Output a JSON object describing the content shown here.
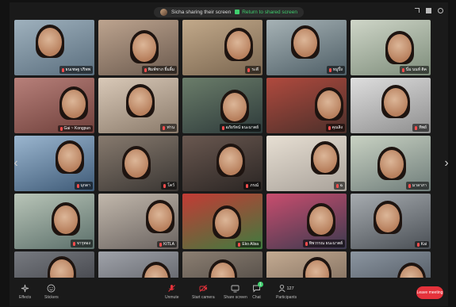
{
  "colors": {
    "accent_green": "#3fcf6e",
    "leave_red": "#e5323b"
  },
  "share_banner": {
    "text": "Sicha sharing their screen",
    "return_label": "Return to shared screen"
  },
  "toolbar": {
    "effects": "Effects",
    "stickers": "Stickers",
    "unmute": "Unmute",
    "start_camera": "Start camera",
    "share_screen": "Share screen",
    "chat": "Chat",
    "chat_badge": "1",
    "participants": "Participants",
    "participant_count": "127",
    "leave": "Leave meeting"
  },
  "participants": [
    {
      "name": "ธนเชษฐ ปริพพ",
      "muted": true
    },
    {
      "name": "พิมพ์ชาภ ยิ้มลิ้ม",
      "muted": true
    },
    {
      "name": "ระดี",
      "muted": true
    },
    {
      "name": "หมูปิ้ง",
      "muted": true
    },
    {
      "name": "นิ๋ม นนท์ ติค",
      "muted": true
    },
    {
      "name": "Gai ~ Kongpun",
      "muted": true
    },
    {
      "name": "ท่าน",
      "muted": true
    },
    {
      "name": "อภัยรัตน์ ธนะมาตย์",
      "muted": true
    },
    {
      "name": "คุณลิง",
      "muted": true
    },
    {
      "name": "ทิพย์",
      "muted": true
    },
    {
      "name": "มุกดา",
      "muted": true
    },
    {
      "name": "โคว์",
      "muted": true
    },
    {
      "name": "ภรณ์",
      "muted": true
    },
    {
      "name": "ฉ",
      "muted": true
    },
    {
      "name": "มาลาภา",
      "muted": true
    },
    {
      "name": "จารุทอง",
      "muted": true
    },
    {
      "name": "KITLA",
      "muted": true
    },
    {
      "name": "Eko Alisa",
      "muted": true
    },
    {
      "name": "ทิพวรรณ ธนะมาตย์",
      "muted": true
    },
    {
      "name": "Kai",
      "muted": true
    },
    {
      "name": "",
      "muted": true
    },
    {
      "name": "",
      "muted": true
    },
    {
      "name": "",
      "muted": true
    },
    {
      "name": "",
      "muted": true
    },
    {
      "name": "",
      "muted": true
    }
  ]
}
